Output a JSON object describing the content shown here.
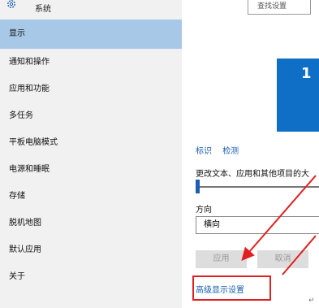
{
  "header": {
    "title": "系统",
    "search_placeholder": "查找设置"
  },
  "sidebar": {
    "items": [
      {
        "label": "显示",
        "selected": true
      },
      {
        "label": "通知和操作"
      },
      {
        "label": "应用和功能"
      },
      {
        "label": "多任务"
      },
      {
        "label": "平板电脑模式"
      },
      {
        "label": "电源和睡眠"
      },
      {
        "label": "存储"
      },
      {
        "label": "脱机地图"
      },
      {
        "label": "默认应用"
      },
      {
        "label": "关于"
      }
    ]
  },
  "display": {
    "monitor_number": "1",
    "identify_link": "标识",
    "detect_link": "检测",
    "scale_label": "更改文本、应用和其他项目的大",
    "scale_value_percent": 0,
    "orientation_label": "方向",
    "orientation_value": "横向",
    "apply_button": "应用",
    "cancel_button": "取消",
    "advanced_link": "高级显示设置"
  },
  "annotation": {
    "highlight_color": "#e02020",
    "paragraph_mark": "↵"
  },
  "colors": {
    "accent": "#0f6fc6",
    "link": "#1a5fb4",
    "selected_bg": "#a8c8e8"
  }
}
